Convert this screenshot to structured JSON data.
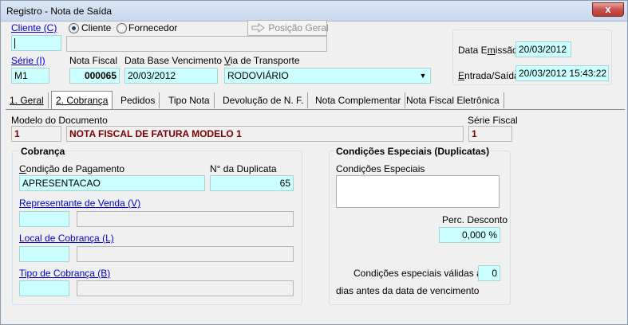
{
  "window": {
    "title": "Registro - Nota de Saída",
    "close_glyph": "x"
  },
  "header": {
    "cliente_link": "Cliente (C)",
    "cliente_code": "",
    "radio_cliente": "Cliente",
    "radio_fornecedor": "Fornecedor",
    "posicao_geral": "Posição Geral",
    "serie_link": "Série (I)",
    "serie_value": "M1",
    "nota_fiscal_label": "Nota Fiscal",
    "nota_fiscal_value": "000065",
    "data_base_label": "Data Base Vencimento",
    "data_base_value": "20/03/2012",
    "via_label": "Via de Transporte",
    "via_value": "RODOVIÁRIO",
    "data_emissao_label": "Data Emissão",
    "data_emissao_value": "20/03/2012",
    "entrada_label": "Entrada/Saída",
    "entrada_value": "20/03/2012 15:43:22"
  },
  "tabs": [
    {
      "label": "1. Geral"
    },
    {
      "label": "2. Cobrança"
    },
    {
      "label": "Pedidos"
    },
    {
      "label": "Tipo Nota"
    },
    {
      "label": "Devolução de N. F."
    },
    {
      "label": "Nota Complementar"
    },
    {
      "label": "Nota Fiscal Eletrônica"
    }
  ],
  "documento": {
    "modelo_label": "Modelo do Documento",
    "modelo_code": "1",
    "modelo_desc": "NOTA FISCAL DE FATURA MODELO 1",
    "serie_fiscal_label": "Série Fiscal",
    "serie_fiscal_value": "1"
  },
  "cobranca": {
    "title": "Cobrança",
    "condicao_label": "Condição de Pagamento",
    "condicao_value": "APRESENTACAO",
    "duplicata_label": "N° da Duplicata",
    "duplicata_value": "65",
    "representante_link": "Representante de Venda (V)",
    "local_link": "Local de Cobrança (L)",
    "tipo_link": "Tipo de Cobrança (B)"
  },
  "condicoes": {
    "title": "Condições Especiais (Duplicatas)",
    "condicoes_label": "Condições Especiais",
    "perc_label": "Perc. Desconto",
    "perc_value": "0,000 %",
    "validas_label": "Condições especiais válidas até",
    "validas_value": "0",
    "dias_label": "dias antes da data de vencimento"
  }
}
